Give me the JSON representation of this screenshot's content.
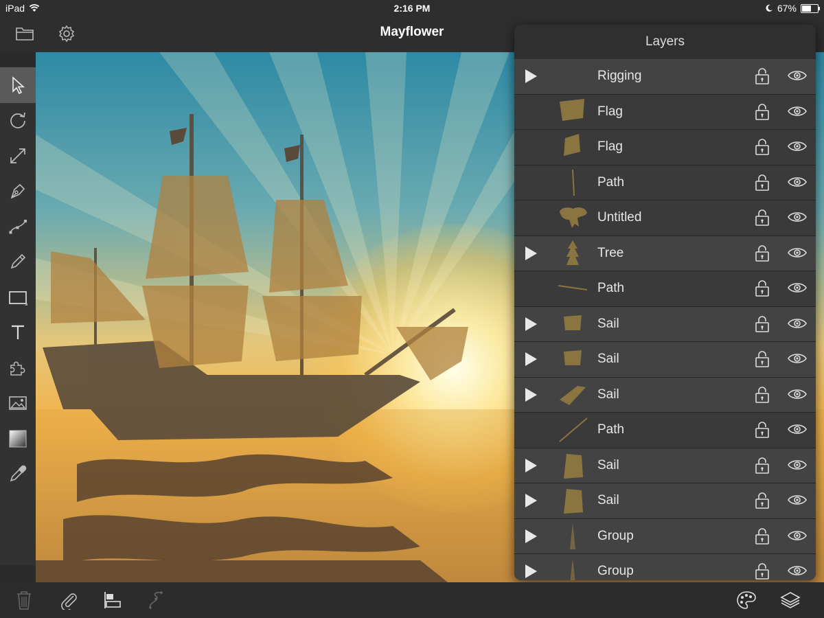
{
  "status_bar": {
    "device": "iPad",
    "time": "2:16 PM",
    "battery": "67%",
    "battery_level": 0.67
  },
  "document": {
    "title": "Mayflower"
  },
  "header": {
    "icons": [
      "folder-icon",
      "gear-icon"
    ]
  },
  "tools": [
    {
      "name": "select",
      "icon": "arrow-pointer-icon",
      "active": true
    },
    {
      "name": "rotate",
      "icon": "rotate-icon"
    },
    {
      "name": "scale",
      "icon": "resize-icon"
    },
    {
      "name": "pen",
      "icon": "pen-nib-icon"
    },
    {
      "name": "node",
      "icon": "bezier-node-icon"
    },
    {
      "name": "pencil",
      "icon": "pencil-icon"
    },
    {
      "name": "rectangle",
      "icon": "rectangle-icon"
    },
    {
      "name": "text",
      "icon": "text-icon"
    },
    {
      "name": "puzzle",
      "icon": "puzzle-icon"
    },
    {
      "name": "image",
      "icon": "image-icon"
    },
    {
      "name": "gradient",
      "icon": "gradient-icon"
    },
    {
      "name": "eyedropper",
      "icon": "eyedropper-icon"
    }
  ],
  "layers_panel": {
    "title": "Layers",
    "layers": [
      {
        "name": "Rigging",
        "group": true,
        "thumb": "none"
      },
      {
        "name": "Flag",
        "group": false,
        "thumb": "flag"
      },
      {
        "name": "Flag",
        "group": false,
        "thumb": "flag2"
      },
      {
        "name": "Path",
        "group": false,
        "thumb": "vline"
      },
      {
        "name": "Untitled",
        "group": false,
        "thumb": "blob"
      },
      {
        "name": "Tree",
        "group": true,
        "thumb": "tree"
      },
      {
        "name": "Path",
        "group": false,
        "thumb": "hline"
      },
      {
        "name": "Sail",
        "group": true,
        "thumb": "sail"
      },
      {
        "name": "Sail",
        "group": true,
        "thumb": "sail"
      },
      {
        "name": "Sail",
        "group": true,
        "thumb": "sail-slant"
      },
      {
        "name": "Path",
        "group": false,
        "thumb": "diag"
      },
      {
        "name": "Sail",
        "group": true,
        "thumb": "sail-tall"
      },
      {
        "name": "Sail",
        "group": true,
        "thumb": "sail-tall"
      },
      {
        "name": "Group",
        "group": true,
        "thumb": "spire"
      },
      {
        "name": "Group",
        "group": true,
        "thumb": "spire"
      }
    ]
  },
  "bottom_bar": {
    "left_icons": [
      "trash-icon",
      "paperclip-icon",
      "align-icon",
      "path-icon"
    ],
    "right_icons": [
      "palette-icon",
      "layers-icon"
    ]
  },
  "colors": {
    "thumb": "#8a7540",
    "panel_bg": "#383838",
    "group_row_bg": "#434343",
    "active_tool_bg": "#5a5a5a"
  }
}
